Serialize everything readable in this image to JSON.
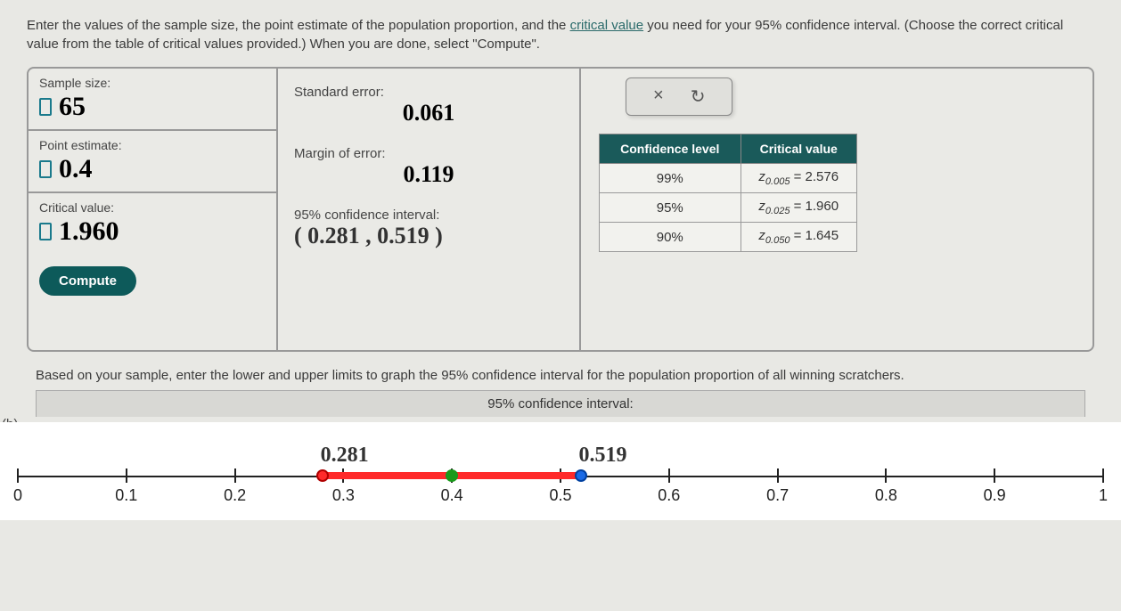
{
  "instructions": "Enter the values of the sample size, the point estimate of the population proportion, and the critical value you need for your 95% confidence interval. (Choose the correct critical value from the table of critical values provided.) When you are done, select \"Compute\".",
  "link_text": "critical value",
  "inputs": {
    "sample_size_label": "Sample size:",
    "sample_size_value": "65",
    "point_estimate_label": "Point estimate:",
    "point_estimate_value": "0.4",
    "critical_value_label": "Critical value:",
    "critical_value_value": "1.960",
    "compute_label": "Compute"
  },
  "results": {
    "se_label": "Standard error:",
    "se_value": "0.061",
    "moe_label": "Margin of error:",
    "moe_value": "0.119",
    "ci_label": "95% confidence interval:",
    "ci_value": "( 0.281 , 0.519 )"
  },
  "toolbar": {
    "close": "×",
    "reset": "↻"
  },
  "crit_table": {
    "h1": "Confidence level",
    "h2": "Critical value",
    "rows": [
      {
        "level": "99%",
        "z_sub": "0.005",
        "z_val": "2.576"
      },
      {
        "level": "95%",
        "z_sub": "0.025",
        "z_val": "1.960"
      },
      {
        "level": "90%",
        "z_sub": "0.050",
        "z_val": "1.645"
      }
    ]
  },
  "part_b_tag": "(b)",
  "part_b_text": "Based on your sample, enter the lower and upper limits to graph the 95% confidence interval for the population proportion of all winning scratchers.",
  "ci_title": "95% confidence interval:",
  "numline": {
    "ticks": [
      "0",
      "0.1",
      "0.2",
      "0.3",
      "0.4",
      "0.5",
      "0.6",
      "0.7",
      "0.8",
      "0.9",
      "1"
    ],
    "lower_label": "0.281",
    "upper_label": "0.519"
  },
  "chart_data": {
    "type": "line",
    "title": "95% confidence interval",
    "x": [
      0,
      0.1,
      0.2,
      0.3,
      0.4,
      0.5,
      0.6,
      0.7,
      0.8,
      0.9,
      1
    ],
    "series": [
      {
        "name": "interval",
        "lower": 0.281,
        "center": 0.4,
        "upper": 0.519
      }
    ],
    "xlabel": "",
    "ylabel": "",
    "xlim": [
      0,
      1
    ]
  }
}
